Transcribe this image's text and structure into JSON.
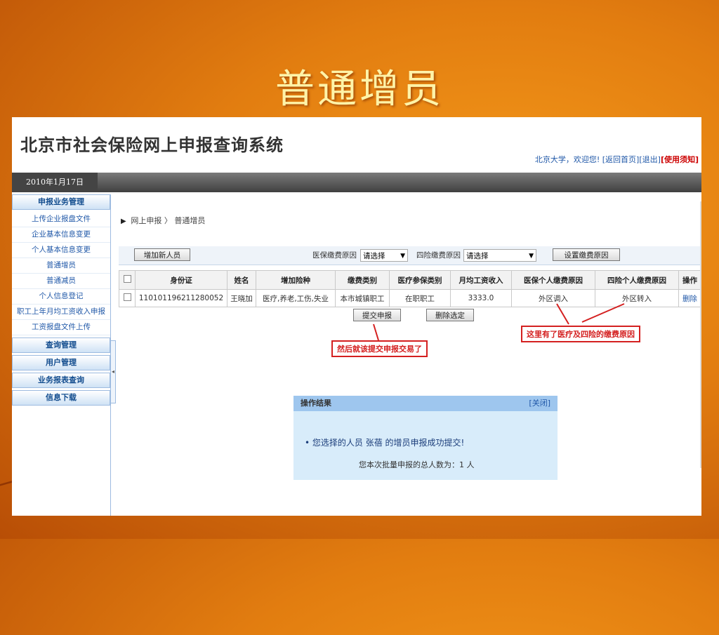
{
  "slide": {
    "title": "普通增员"
  },
  "app": {
    "title": "北京市社会保险网上申报查询系统",
    "welcome": "北京大学，欢迎您!",
    "links": [
      "[返回首页]",
      "[退出]",
      "[使用须知]"
    ],
    "date": "2010年1月17日"
  },
  "sidebar": {
    "section1": "申报业务管理",
    "items": [
      "上传企业报盘文件",
      "企业基本信息变更",
      "个人基本信息变更",
      "普通增员",
      "普通减员",
      "个人信息登记",
      "职工上年月均工资收入申报",
      "工资报盘文件上传"
    ],
    "sections": [
      "查询管理",
      "用户管理",
      "业务报表查询",
      "信息下载"
    ]
  },
  "breadcrumb": {
    "parent": "网上申报",
    "sep": "〉",
    "current": "普通增员"
  },
  "toolbar": {
    "add_label": "增加新人员",
    "medical_reason_label": "医保缴费原因",
    "medical_reason_value": "请选择",
    "four_reason_label": "四险缴费原因",
    "four_reason_value": "请选择",
    "set_reason_label": "设置缴费原因"
  },
  "table": {
    "headers": [
      "身份证",
      "姓名",
      "增加险种",
      "缴费类别",
      "医疗参保类别",
      "月均工资收入",
      "医保个人缴费原因",
      "四险个人缴费原因",
      "操作"
    ],
    "rows": [
      {
        "id": "110101196211280052",
        "name": "王晓加",
        "insurance": "医疗,养老,工伤,失业",
        "pay_type": "本市城镇职工",
        "medical_type": "在职职工",
        "salary": "3333.0",
        "med_reason": "外区调入",
        "four_reason": "外区转入",
        "action": "删除"
      }
    ]
  },
  "actions": {
    "submit": "提交申报",
    "delete_selected": "删除选定"
  },
  "annotations": {
    "submit_note": "然后就该提交申报交易了",
    "reason_note": "这里有了医疗及四险的缴费原因"
  },
  "result": {
    "title": "操作结果",
    "close": "[关闭]",
    "message": "您选择的人员 张蓓 的增员申报成功提交!",
    "count": "您本次批量申报的总人数为：1 人"
  }
}
